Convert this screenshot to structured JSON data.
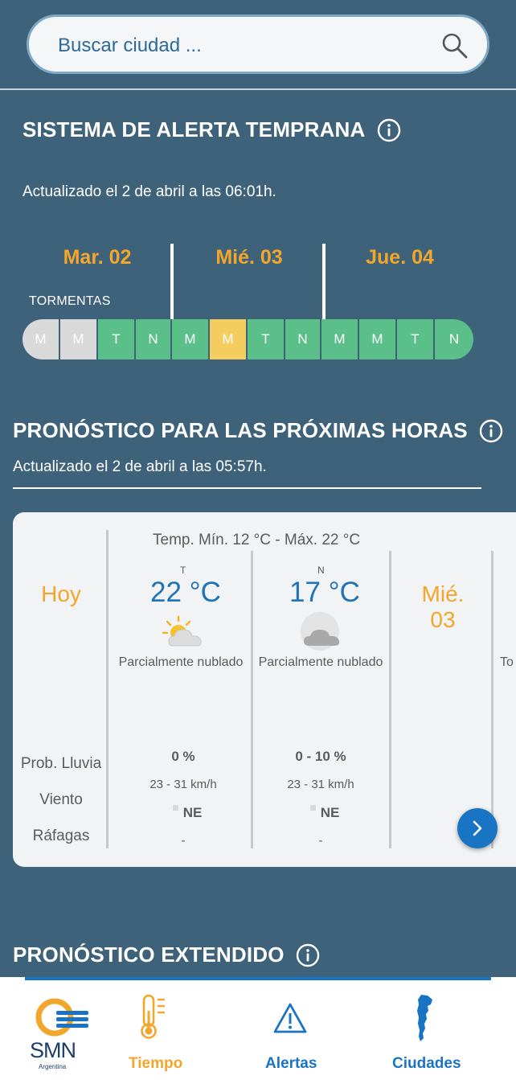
{
  "search": {
    "placeholder": "Buscar ciudad ..."
  },
  "alert_system": {
    "title": "SISTEMA DE ALERTA TEMPRANA",
    "updated": "Actualizado el 2 de abril a las 06:01h.",
    "days": [
      "Mar. 02",
      "Mié. 03",
      "Jue. 04"
    ],
    "phenomenon": "TORMENTAS",
    "segments": [
      {
        "label": "M",
        "level": "none"
      },
      {
        "label": "M",
        "level": "none"
      },
      {
        "label": "T",
        "level": "green"
      },
      {
        "label": "N",
        "level": "green"
      },
      {
        "label": "M",
        "level": "green"
      },
      {
        "label": "M",
        "level": "yellow"
      },
      {
        "label": "T",
        "level": "green"
      },
      {
        "label": "N",
        "level": "green"
      },
      {
        "label": "M",
        "level": "green"
      },
      {
        "label": "M",
        "level": "green"
      },
      {
        "label": "T",
        "level": "green"
      },
      {
        "label": "N",
        "level": "green"
      }
    ],
    "colors": {
      "grey": "#d9d9d9",
      "green": "#5bbf8a",
      "yellow": "#f5cd5f",
      "day": "#f2a62b"
    }
  },
  "hourly": {
    "title": "PRONÓSTICO PARA LAS PRÓXIMAS HORAS",
    "updated": "Actualizado el 2 de abril a las 05:57h.",
    "temp_range": "Temp. Mín. 12 °C - Máx. 22 °C",
    "today_label": "Hoy",
    "row_labels": {
      "rain": "Prob. Lluvia",
      "wind": "Viento",
      "gusts": "Ráfagas"
    },
    "periods": [
      {
        "letter": "T",
        "temp": "22 °C",
        "icon": "sun-cloud-icon",
        "desc": "Parcialmente nublado",
        "rain": "0 %",
        "wind": "23 - 31 km/h",
        "dir": "NE",
        "gusts": "-"
      },
      {
        "letter": "N",
        "temp": "17 °C",
        "icon": "moon-cloud-icon",
        "desc": "Parcialmente nublado",
        "rain": "0 - 10 %",
        "wind": "23 - 31 km/h",
        "dir": "NE",
        "gusts": "-"
      }
    ],
    "next_day": {
      "name": "Mié.",
      "num": "03"
    },
    "partial_text": "To"
  },
  "extended": {
    "title": "PRONÓSTICO EXTENDIDO"
  },
  "nav": {
    "logo_text": "SMN",
    "logo_sub": "Argentina",
    "items": [
      {
        "label": "Tiempo",
        "icon": "thermometer-icon",
        "active": true
      },
      {
        "label": "Alertas",
        "icon": "warning-triangle-icon",
        "active": false
      },
      {
        "label": "Ciudades",
        "icon": "argentina-map-icon",
        "active": false
      }
    ]
  }
}
